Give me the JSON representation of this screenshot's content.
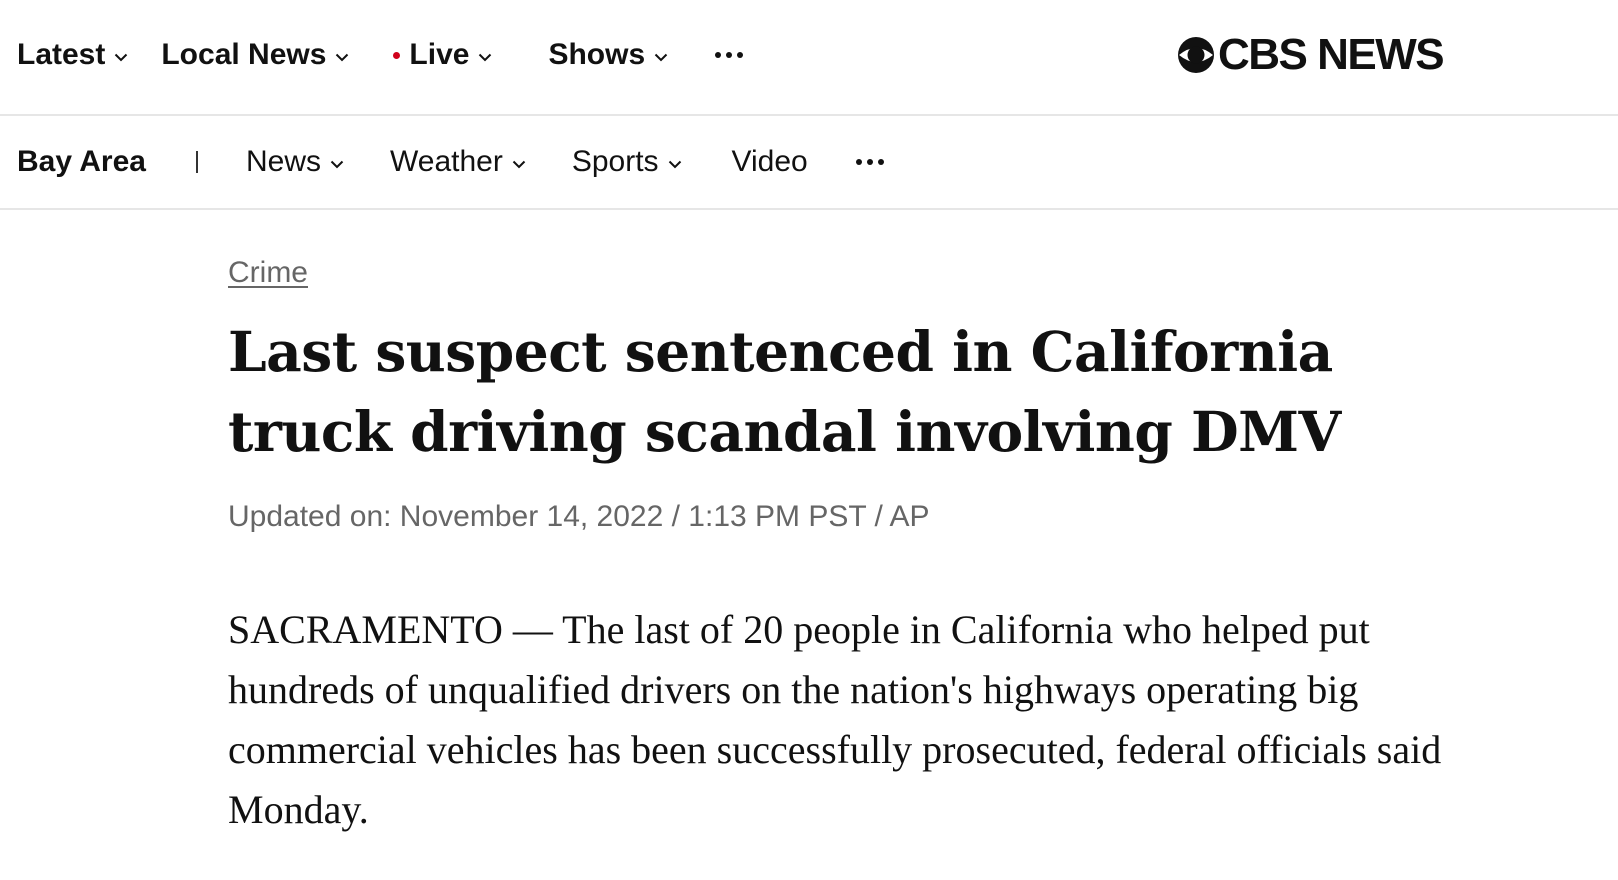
{
  "top_nav": {
    "items": [
      {
        "label": "Latest"
      },
      {
        "label": "Local News"
      },
      {
        "label": "Live"
      },
      {
        "label": "Shows"
      }
    ]
  },
  "logo": {
    "text": "CBS NEWS"
  },
  "sub_nav": {
    "brand": "Bay Area",
    "items": [
      {
        "label": "News"
      },
      {
        "label": "Weather"
      },
      {
        "label": "Sports"
      },
      {
        "label": "Video"
      }
    ]
  },
  "article": {
    "category": "Crime",
    "headline": "Last suspect sentenced in California truck driving scandal involving DMV",
    "meta": "Updated on: November 14, 2022 / 1:13 PM PST / AP",
    "body": "SACRAMENTO — The last of 20 people in California who helped put hundreds of unqualified drivers on the nation's highways operating big commercial vehicles has been successfully prosecuted, federal officials said Monday."
  },
  "colors": {
    "live_dot": "#d0021b",
    "meta_text": "#666666",
    "divider": "#e6e6e6"
  },
  "icons": [
    "chevron-down-icon",
    "more-dots-icon",
    "cbs-eye-icon"
  ]
}
